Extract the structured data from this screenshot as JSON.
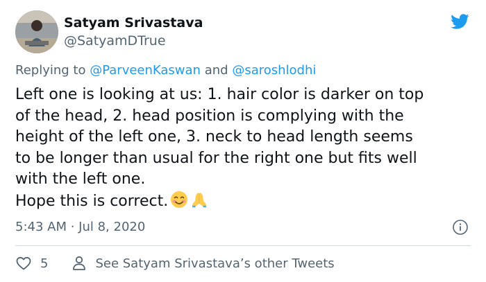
{
  "author": {
    "name": "Satyam Srivastava",
    "handle": "@SatyamDTrue"
  },
  "reply": {
    "prefix": "Replying to",
    "mention1": "@ParveenKaswan",
    "joiner": "and",
    "mention2": "@saroshlodhi"
  },
  "tweet": {
    "lines": [
      "Left one is looking at us: 1. hair color is darker on top",
      "of the head, 2. head position is complying with the",
      "height of the left one, 3. neck to head length seems",
      "to be longer than usual for the right one but fits well",
      "with the left one.",
      "Hope this is correct."
    ],
    "emojis": [
      "smiling-face-emoji",
      "folded-hands-emoji"
    ]
  },
  "meta": {
    "timestamp": "5:43 AM · Jul 8, 2020"
  },
  "actions": {
    "like_count": "5",
    "other_tweets_label": "See Satyam Srivastava’s other Tweets"
  },
  "icons": {
    "brand": "twitter-bird-icon",
    "info": "info-icon",
    "like": "heart-icon",
    "profile": "person-icon"
  },
  "colors": {
    "twitter_blue": "#1d9bf0",
    "secondary_text": "#536471",
    "primary_text": "#0f1419",
    "divider": "#cfd9de"
  }
}
